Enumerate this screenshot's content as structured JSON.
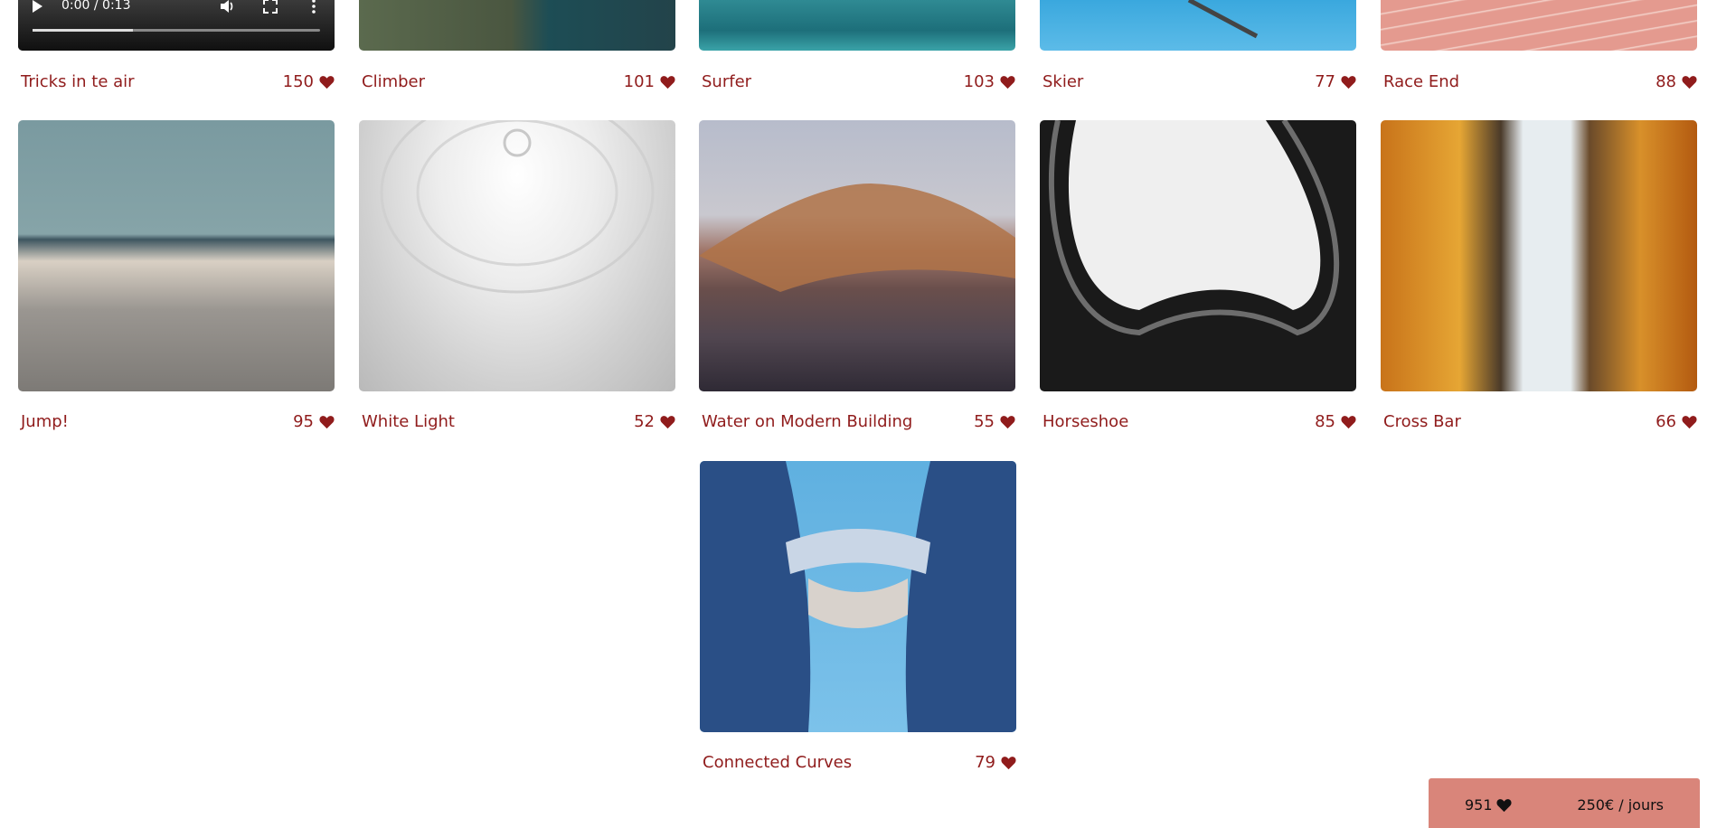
{
  "video_controls": {
    "time": "0:00 / 0:13"
  },
  "cards": [
    {
      "title": "Tricks in te air",
      "likes": "150"
    },
    {
      "title": "Climber",
      "likes": "101"
    },
    {
      "title": "Surfer",
      "likes": "103"
    },
    {
      "title": "Skier",
      "likes": "77"
    },
    {
      "title": "Race End",
      "likes": "88"
    },
    {
      "title": "Jump!",
      "likes": "95"
    },
    {
      "title": "White Light",
      "likes": "52"
    },
    {
      "title": "Water on Modern Building",
      "likes": "55"
    },
    {
      "title": "Horseshoe",
      "likes": "85"
    },
    {
      "title": "Cross Bar",
      "likes": "66"
    },
    {
      "title": "Connected Curves",
      "likes": "79"
    }
  ],
  "footer": {
    "total_likes": "951",
    "rate": "250€ / jours"
  },
  "colors": {
    "accent": "#901c1c",
    "footer_bg": "#d9857a"
  }
}
